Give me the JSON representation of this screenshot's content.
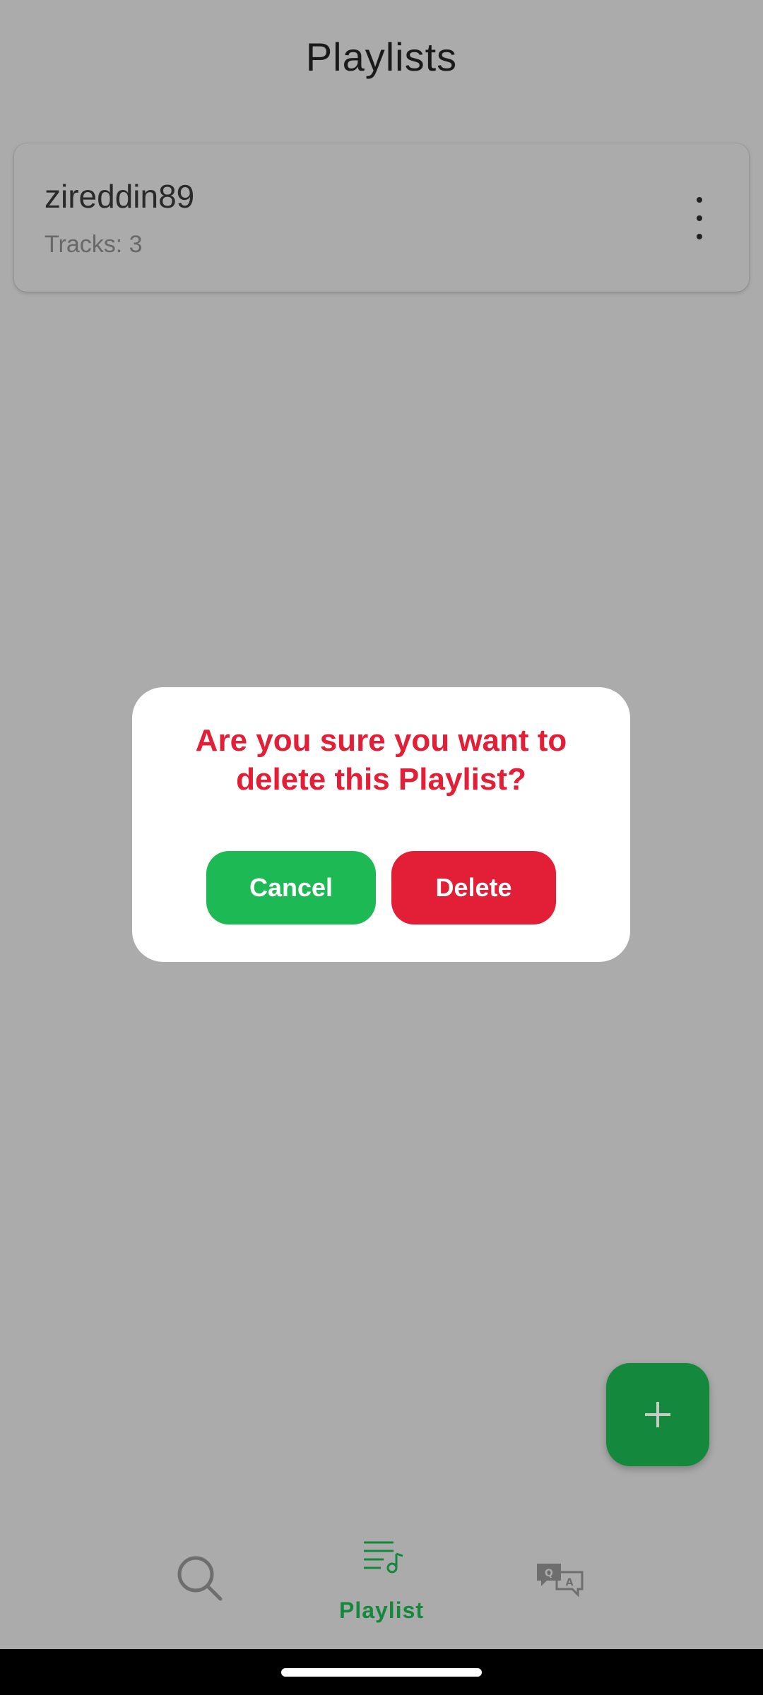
{
  "header": {
    "title": "Playlists"
  },
  "playlists": [
    {
      "name": "zireddin89",
      "tracks_label": "Tracks: 3",
      "more_icon": "more-vertical-icon"
    }
  ],
  "dialog": {
    "message": "Are you sure you want to delete this Playlist?",
    "cancel_label": "Cancel",
    "delete_label": "Delete"
  },
  "fab": {
    "icon": "plus-icon"
  },
  "bottom_nav": {
    "items": [
      {
        "icon": "search-icon",
        "label": ""
      },
      {
        "icon": "playlist-icon",
        "label": "Playlist",
        "active": true
      },
      {
        "icon": "qa-icon",
        "label": ""
      }
    ]
  },
  "colors": {
    "overlay_bg": "#ababab",
    "accent_green": "#14883c",
    "cancel_green": "#1db954",
    "danger_red": "#e31f37"
  }
}
